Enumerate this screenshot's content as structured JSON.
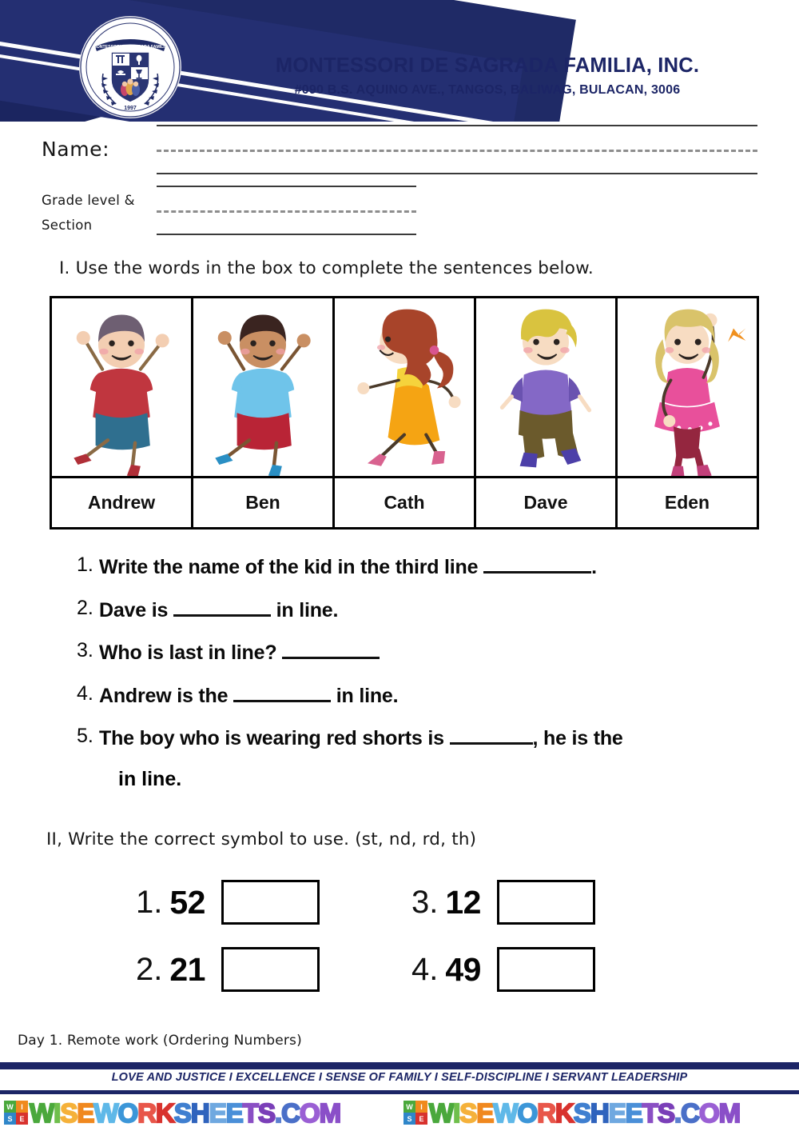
{
  "header": {
    "school_name": "MONTESSORI DE SAGRADA FAMILIA, INC.",
    "address": "#090 B.S. AQUINO AVE., TANGOS, BALIWAG, BULACAN, 3006",
    "logo_icon": "school-crest-icon",
    "logo_ribbon_text": "MONTESSORI DE SAGRADA FAMILIA",
    "logo_year": "1997",
    "brand_navy": "#1c2566"
  },
  "form": {
    "name_label": "Name:",
    "grade_label_line1": "Grade level &",
    "grade_label_line2": "Section",
    "name_value": "",
    "grade_value": ""
  },
  "part1": {
    "instruction": "I. Use the words in the box to complete the sentences below.",
    "kids": [
      {
        "name": "Andrew",
        "icon": "kid-jumping-icon",
        "hair": "#6e5f72",
        "shirt": "#c0363f",
        "pants": "#2f6f8f",
        "shoes": "#b02f38",
        "skin": "#f3ceb2",
        "pose": "jump-front"
      },
      {
        "name": "Ben",
        "icon": "kid-jumping-icon",
        "hair": "#3a2420",
        "shirt": "#6fc4ea",
        "pants": "#b92436",
        "shoes": "#2a8fc4",
        "skin": "#c98f63",
        "pose": "jump-front"
      },
      {
        "name": "Cath",
        "icon": "girl-running-icon",
        "hair": "#a8442a",
        "shirt": "#f5d33c",
        "pants": "#f5a413",
        "shoes": "#d8628f",
        "skin": "#f7dcc2",
        "pose": "run-side"
      },
      {
        "name": "Dave",
        "icon": "kid-running-icon",
        "hair": "#d9c33f",
        "shirt": "#8468c6",
        "pants": "#6b5a2c",
        "shoes": "#4c3fa8",
        "skin": "#f7dcc2",
        "pose": "run-front"
      },
      {
        "name": "Eden",
        "icon": "girl-waving-icon",
        "hair": "#d9c36a",
        "shirt": "#e8509b",
        "pants": "#94263f",
        "shoes": "#c2407a",
        "skin": "#f7dcc2",
        "pose": "stand-wave"
      }
    ],
    "questions": [
      {
        "number": "1.",
        "segments": [
          {
            "type": "text",
            "value": "Write the name of the kid in the third line "
          },
          {
            "type": "blank",
            "size": "b-long"
          },
          {
            "type": "text",
            "value": "."
          }
        ]
      },
      {
        "number": "2.",
        "segments": [
          {
            "type": "text",
            "value": "Dave is "
          },
          {
            "type": "blank",
            "size": "b-med"
          },
          {
            "type": "text",
            "value": " in line."
          }
        ]
      },
      {
        "number": "3.",
        "segments": [
          {
            "type": "text",
            "value": "Who is last in line? "
          },
          {
            "type": "blank",
            "size": "b-med"
          }
        ]
      },
      {
        "number": "4.",
        "segments": [
          {
            "type": "text",
            "value": "Andrew is the "
          },
          {
            "type": "blank",
            "size": "b-med"
          },
          {
            "type": "text",
            "value": " in line."
          }
        ]
      },
      {
        "number": "5.",
        "segments": [
          {
            "type": "text",
            "value": "The boy who is wearing red shorts is "
          },
          {
            "type": "blank",
            "size": "b-short"
          },
          {
            "type": "text",
            "value": ", he is the"
          }
        ],
        "continuation": [
          {
            "type": "blank",
            "size": "b-xs"
          },
          {
            "type": "text",
            "value": " in line."
          }
        ]
      }
    ]
  },
  "part2": {
    "instruction": "II, Write the correct symbol to use. (st, nd, rd, th)",
    "items": [
      {
        "number": "1.",
        "value": "52",
        "answer": ""
      },
      {
        "number": "2.",
        "value": "21",
        "answer": ""
      },
      {
        "number": "3.",
        "value": "12",
        "answer": ""
      },
      {
        "number": "4.",
        "value": "49",
        "answer": ""
      }
    ]
  },
  "footer": {
    "day_note": "Day 1. Remote work (Ordering Numbers)",
    "motto": "LOVE AND JUSTICE  I  EXCELLENCE  I  SENSE OF FAMILY  I  SELF-DISCIPLINE  I  SERVANT LEADERSHIP",
    "watermark": {
      "badge_letters": [
        "W",
        "I",
        "S",
        "E"
      ],
      "badge_colors": [
        "#4aa83c",
        "#f08a1e",
        "#2f86c9",
        "#d8322e"
      ],
      "text": "WISEWORKSHEETS.COM",
      "letter_colors": [
        "#4aa83c",
        "#6fbf4c",
        "#f5b13a",
        "#f0881f",
        "#5fb8e8",
        "#3c96d8",
        "#e8564a",
        "#d8322e",
        "#3f7fd0",
        "#2f63bd",
        "#6fa8e0",
        "#4a8fd8",
        "#8a4fc4",
        "#7a3fb8",
        "#5a7fd0",
        "#4a6fc8",
        "#9a5fd4",
        "#8a4fc8"
      ],
      "repeat": 2
    }
  }
}
